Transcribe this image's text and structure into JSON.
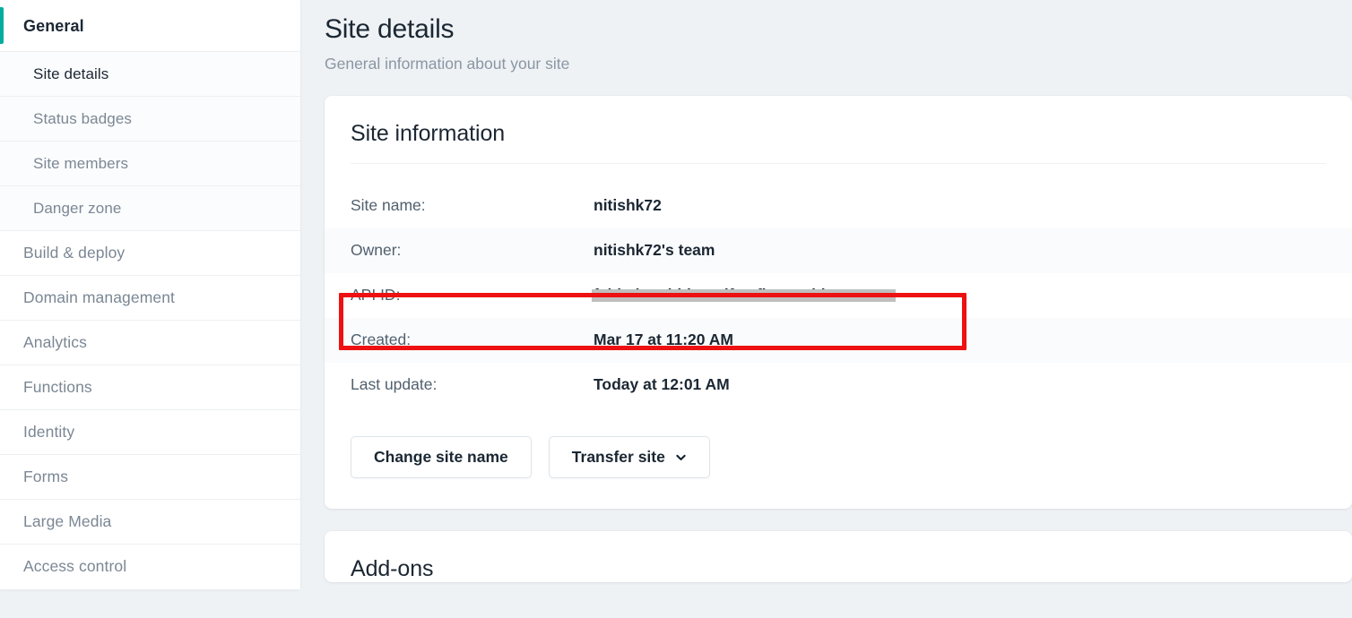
{
  "sidebar": {
    "items": [
      {
        "label": "General",
        "level": "group",
        "active": false,
        "name": "sidebar-group-general"
      },
      {
        "label": "Site details",
        "level": "sub",
        "active": true,
        "name": "sidebar-item-site-details"
      },
      {
        "label": "Status badges",
        "level": "sub",
        "active": false,
        "name": "sidebar-item-status-badges"
      },
      {
        "label": "Site members",
        "level": "sub",
        "active": false,
        "name": "sidebar-item-site-members"
      },
      {
        "label": "Danger zone",
        "level": "sub",
        "active": false,
        "name": "sidebar-item-danger-zone"
      },
      {
        "label": "Build & deploy",
        "level": "top",
        "active": false,
        "name": "sidebar-item-build-deploy"
      },
      {
        "label": "Domain management",
        "level": "top",
        "active": false,
        "name": "sidebar-item-domain-management"
      },
      {
        "label": "Analytics",
        "level": "top",
        "active": false,
        "name": "sidebar-item-analytics"
      },
      {
        "label": "Functions",
        "level": "top",
        "active": false,
        "name": "sidebar-item-functions"
      },
      {
        "label": "Identity",
        "level": "top",
        "active": false,
        "name": "sidebar-item-identity"
      },
      {
        "label": "Forms",
        "level": "top",
        "active": false,
        "name": "sidebar-item-forms"
      },
      {
        "label": "Large Media",
        "level": "top",
        "active": false,
        "name": "sidebar-item-large-media"
      },
      {
        "label": "Access control",
        "level": "top",
        "active": false,
        "name": "sidebar-item-access-control"
      }
    ],
    "accent_color": "#00ad9f"
  },
  "header": {
    "title": "Site details",
    "subtitle": "General information about your site"
  },
  "site_information": {
    "card_title": "Site information",
    "rows": [
      {
        "label": "Site name:",
        "value": "nitishk72",
        "redacted": false,
        "name": "info-row-site-name"
      },
      {
        "label": "Owner:",
        "value": "nitishk72's team",
        "redacted": false,
        "name": "info-row-owner"
      },
      {
        "label": "API ID:",
        "value": "fabbeb1c-bbb2-4df2-afb1-491bb705206c",
        "redacted": true,
        "name": "info-row-api-id"
      },
      {
        "label": "Created:",
        "value": "Mar 17 at 11:20 AM",
        "redacted": false,
        "name": "info-row-created"
      },
      {
        "label": "Last update:",
        "value": "Today at 12:01 AM",
        "redacted": false,
        "name": "info-row-last-update"
      }
    ],
    "buttons": {
      "change_site_name": "Change site name",
      "transfer_site": "Transfer site",
      "transfer_site_icon": "chevron-down-icon"
    }
  },
  "addons": {
    "card_title": "Add-ons"
  },
  "annotation": {
    "highlight_color": "#ee1111",
    "target": "API ID:"
  }
}
